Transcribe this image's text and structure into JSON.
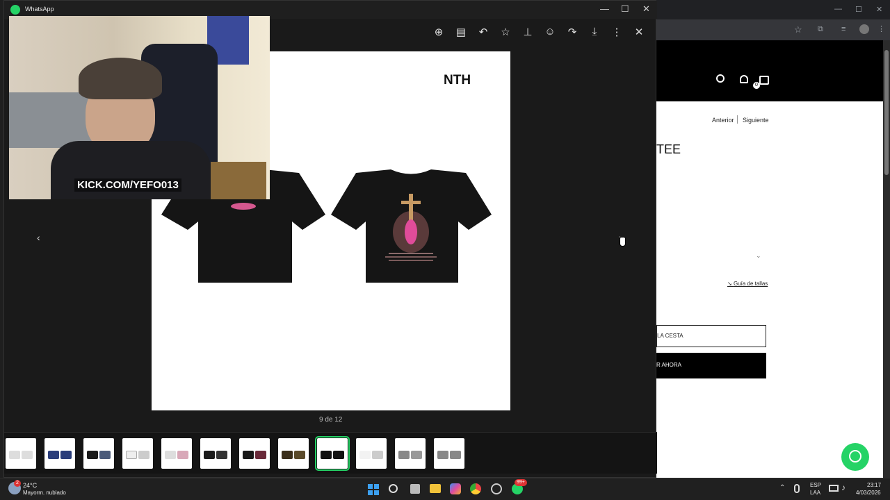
{
  "whatsapp": {
    "title": "WhatsApp",
    "window_controls": {
      "minimize": "—",
      "maximize": "☐",
      "close": "✕"
    },
    "toolbar_icons": [
      "zoom-in-icon",
      "caption-icon",
      "reply-icon",
      "star-icon",
      "pin-icon",
      "emoji-icon",
      "forward-icon",
      "download-icon",
      "more-icon",
      "close-icon"
    ],
    "image": {
      "brand": "NTH"
    },
    "counter": "9 de 12",
    "prev_glyph": "‹",
    "next_glyph": "›",
    "thumbnails_count": 12,
    "selected_thumbnail": 9
  },
  "webcam": {
    "overlay_text": "KICK.COM/YEFO013"
  },
  "browser_page": {
    "nav_prev": "Anterior",
    "nav_next": "Siguiente",
    "product_title_partial": "TEE",
    "size_guide": "Guía de tallas",
    "add_to_cart_partial": "LA CESTA",
    "buy_now_partial": "R AHORA",
    "cart_count": "0"
  },
  "taskbar": {
    "weather_temp": "24°C",
    "weather_desc": "Mayorm. nublado",
    "notif_badge": "2",
    "wa_badge": "99+",
    "lang_top": "ESP",
    "lang_bottom": "LAA",
    "time": "23:17",
    "date": "4/03/2026"
  },
  "colors": {
    "accent": "#25d366",
    "dark": "#1a1a1a"
  }
}
